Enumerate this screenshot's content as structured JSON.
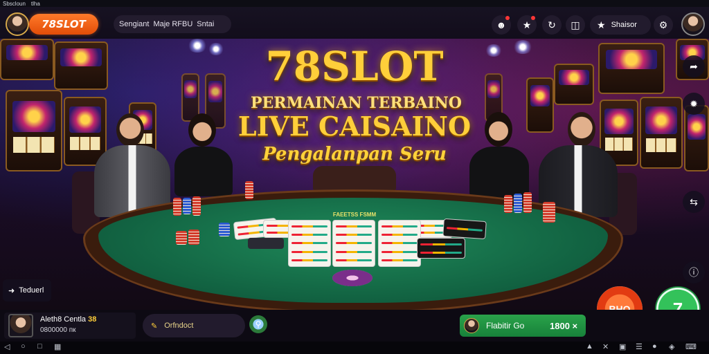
{
  "status_bar": {
    "left_text": "Sbscloun",
    "right_text": "tlha"
  },
  "header": {
    "brand": "78SLOT",
    "marquee": [
      "Sengiant",
      "Maje RFBU",
      "Sntai"
    ],
    "shop_label": "Shaisor"
  },
  "banner": {
    "brand": "78SLOT",
    "line1": "PERMAINAN TERBAINO",
    "line2": "LIVE CAISAINO",
    "line3": "Pengalanpan Seru"
  },
  "table": {
    "sign": "FAEETSS FSMM"
  },
  "exit_label": "Teduerl",
  "player": {
    "name": "Aleth8 Centla",
    "level": "38",
    "coins": "0800000 пк"
  },
  "chat": {
    "placeholder": "Orfndoct"
  },
  "balance": {
    "label": "Flabitir Go",
    "amount": "1800 ×"
  },
  "actions": {
    "spin_label": "BHO"
  },
  "colors": {
    "brand_orange": "#ff6a1a",
    "gold": "#ffcf3a",
    "felt_green": "#127048",
    "balance_green": "#22973f"
  },
  "icons": [
    "person-icon",
    "trophy-icon",
    "clock-icon",
    "layout-icon",
    "star-icon",
    "gear-icon",
    "share-icon",
    "link-icon",
    "info-icon",
    "back-icon",
    "chat-icon",
    "search-icon"
  ]
}
